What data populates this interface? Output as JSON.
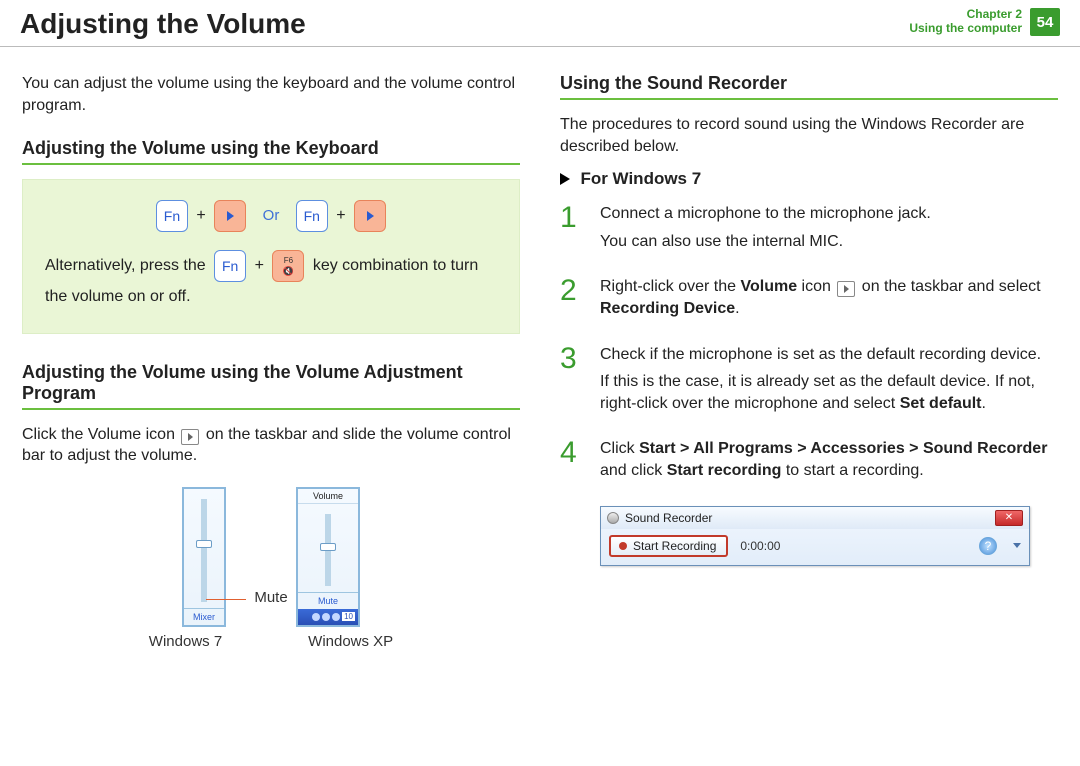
{
  "header": {
    "title": "Adjusting the Volume",
    "chapter_line1": "Chapter 2",
    "chapter_line2": "Using the computer",
    "page": "54"
  },
  "left": {
    "intro": "You can adjust the volume using the keyboard and the volume control program.",
    "h_keyboard": "Adjusting the Volume using the Keyboard",
    "fn": "Fn",
    "or": "Or",
    "plus": "+",
    "f6": "F6",
    "alt_prefix": "Alternatively, press the ",
    "alt_suffix": " key combination to turn the volume on or off.",
    "h_program": "Adjusting the Volume using the Volume Adjustment Program",
    "program_p_a": "Click the Volume icon ",
    "program_p_b": " on the taskbar and slide the volume control bar to adjust the volume.",
    "slider_xp_title": "Volume",
    "mixer": "Mixer",
    "mute_small": "Mute",
    "mute_label": "Mute",
    "cap_win7": "Windows 7",
    "cap_xp": "Windows XP",
    "tray_time": "10"
  },
  "right": {
    "h_recorder": "Using the Sound Recorder",
    "intro": "The procedures to record sound using the Windows Recorder are described below.",
    "for_win7": "For Windows 7",
    "steps": {
      "s1a": "Connect a microphone to the microphone jack.",
      "s1b": "You can also use the internal MIC.",
      "s2a": "Right-click over the ",
      "s2b": "Volume",
      "s2c": " icon ",
      "s2d": " on the taskbar and select ",
      "s2e": "Recording Device",
      "s2f": ".",
      "s3a": "Check if the microphone is set as the default recording device.",
      "s3b_a": "If this is the case, it is already set as the default device. If not, right-click over the microphone and select ",
      "s3b_b": "Set default",
      "s3b_c": ".",
      "s4a": "Click ",
      "s4b": "Start > All Programs > Accessories > Sound Recorder",
      "s4c": " and click ",
      "s4d": "Start recording",
      "s4e": " to start a recording."
    },
    "numbers": {
      "n1": "1",
      "n2": "2",
      "n3": "3",
      "n4": "4"
    },
    "sr": {
      "title": "Sound Recorder",
      "close": "✕",
      "button": "Start Recording",
      "time": "0:00:00",
      "help": "?"
    }
  }
}
